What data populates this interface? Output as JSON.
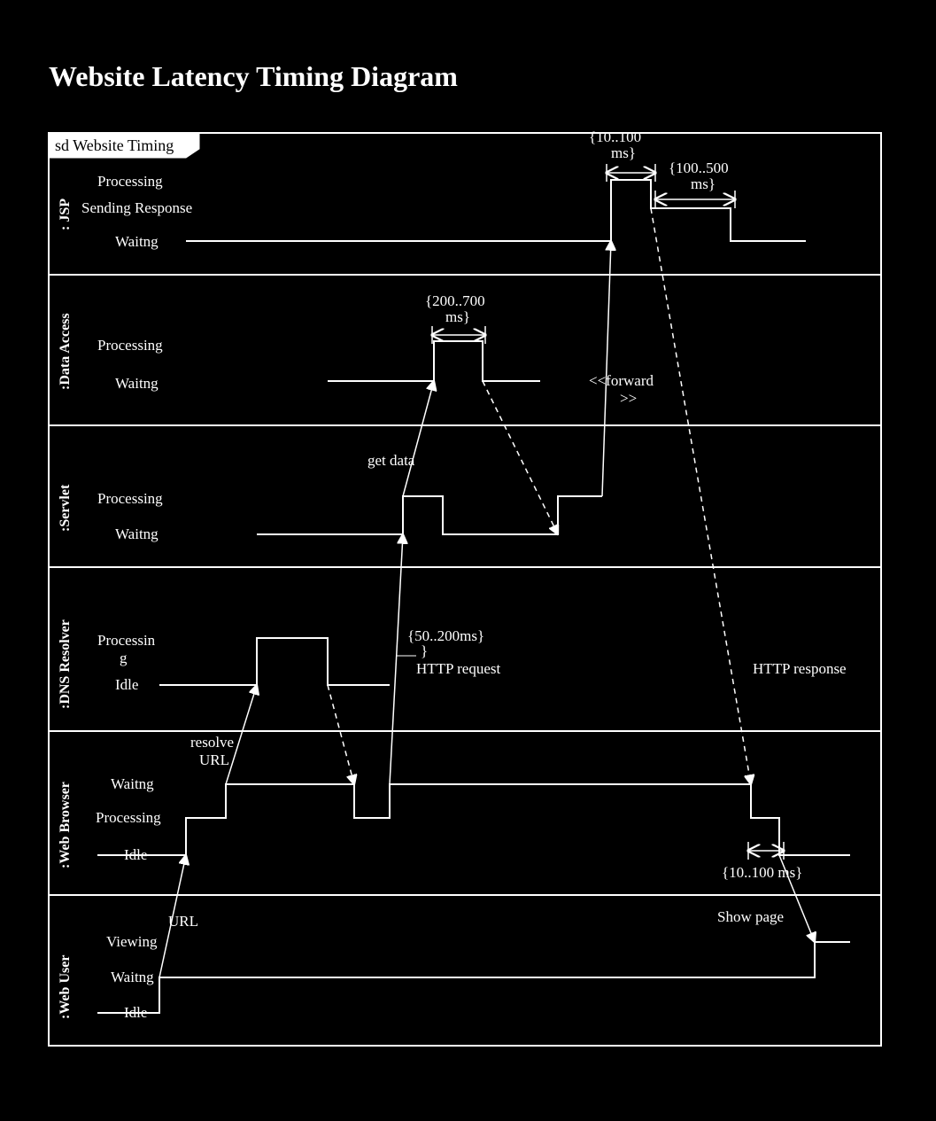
{
  "title": "Website Latency Timing Diagram",
  "frame_label": "sd Website Timing",
  "lanes": {
    "jsp": {
      "name": ": JSP",
      "states": [
        "Processing",
        "Sending Response",
        "Waitng"
      ]
    },
    "data_access": {
      "name": ":Data Access",
      "states": [
        "Processing",
        "Waitng"
      ]
    },
    "servlet": {
      "name": ":Servlet",
      "states": [
        "Processing",
        "Waitng"
      ]
    },
    "dns": {
      "name": ":DNS Resolver",
      "states": [
        "Processing",
        "Idle"
      ]
    },
    "browser": {
      "name": ":Web Browser",
      "states": [
        "Waitng",
        "Processing",
        "Idle"
      ]
    },
    "user": {
      "name": ":Web User",
      "states": [
        "Viewing",
        "Waitng",
        "Idle"
      ]
    }
  },
  "constraints": {
    "c1": "{10..100 ms}",
    "c2": "{100..500 ms}",
    "c3": "{200..700 ms}",
    "c4": "{50..200ms}",
    "c5": "{10..100 ms}"
  },
  "messages": {
    "resolve_url": "resolve URL",
    "get_data": "get data",
    "forward": "<<forward>>",
    "http_request": "HTTP request",
    "http_response": "HTTP response",
    "url": "URL",
    "show_page": "Show page"
  }
}
